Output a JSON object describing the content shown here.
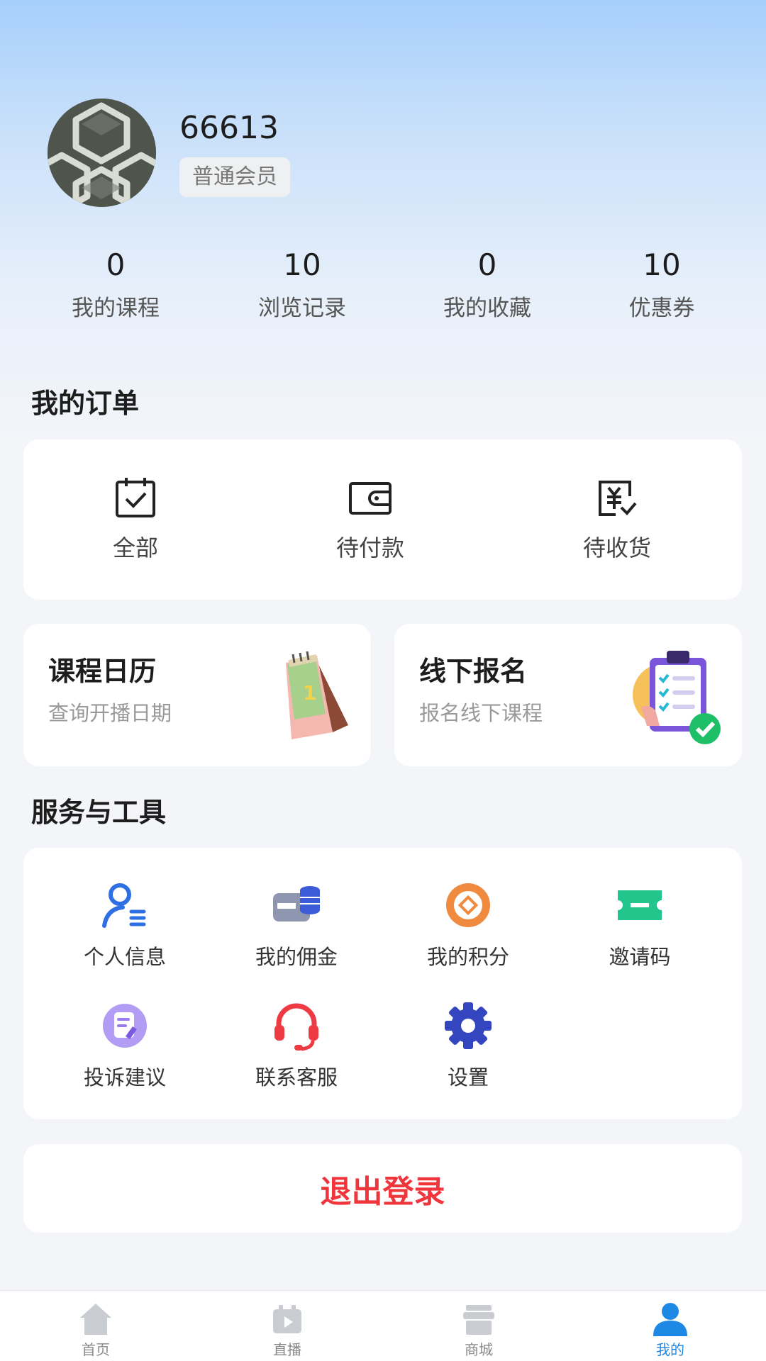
{
  "profile": {
    "username": "66613",
    "member_level": "普通会员"
  },
  "stats": [
    {
      "value": "0",
      "label": "我的课程"
    },
    {
      "value": "10",
      "label": "浏览记录"
    },
    {
      "value": "0",
      "label": "我的收藏"
    },
    {
      "value": "10",
      "label": "优惠券"
    }
  ],
  "orders": {
    "title": "我的订单",
    "items": [
      {
        "label": "全部",
        "icon": "calendar-check-icon"
      },
      {
        "label": "待付款",
        "icon": "wallet-icon"
      },
      {
        "label": "待收货",
        "icon": "yen-receipt-icon"
      }
    ]
  },
  "promos": [
    {
      "title": "课程日历",
      "subtitle": "查询开播日期",
      "icon": "desk-calendar-icon"
    },
    {
      "title": "线下报名",
      "subtitle": "报名线下课程",
      "icon": "clipboard-checklist-icon"
    }
  ],
  "services": {
    "title": "服务与工具",
    "items": [
      {
        "label": "个人信息",
        "icon": "user-info-icon",
        "color": "#2f6fe4"
      },
      {
        "label": "我的佣金",
        "icon": "commission-icon",
        "color": "#3c5bd9"
      },
      {
        "label": "我的积分",
        "icon": "points-coin-icon",
        "color": "#f08a3e"
      },
      {
        "label": "邀请码",
        "icon": "ticket-icon",
        "color": "#22c58b"
      },
      {
        "label": "投诉建议",
        "icon": "feedback-icon",
        "color": "#9b7cf0"
      },
      {
        "label": "联系客服",
        "icon": "headset-icon",
        "color": "#ee3a43"
      },
      {
        "label": "设置",
        "icon": "gear-icon",
        "color": "#3346c0"
      }
    ]
  },
  "logout": {
    "label": "退出登录"
  },
  "tabbar": {
    "items": [
      {
        "label": "首页",
        "icon": "home-icon"
      },
      {
        "label": "直播",
        "icon": "live-tv-icon"
      },
      {
        "label": "商城",
        "icon": "store-icon"
      },
      {
        "label": "我的",
        "icon": "person-icon"
      }
    ],
    "active_index": 3,
    "active_color": "#1e88e5",
    "inactive_color": "#c9ccd1"
  }
}
